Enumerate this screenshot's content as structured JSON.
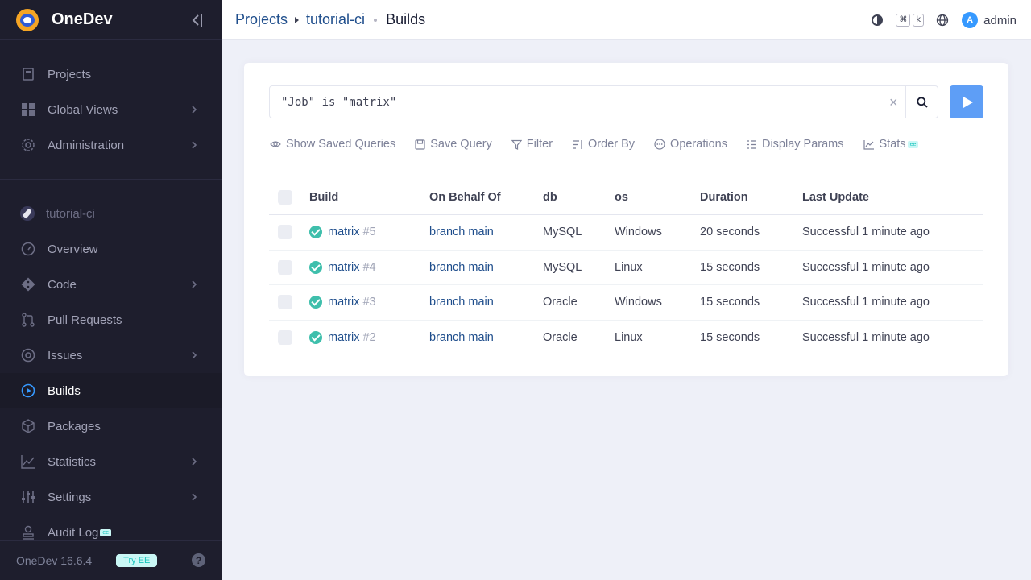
{
  "sidebar": {
    "brand": "OneDev",
    "global_items": [
      {
        "label": "Projects",
        "icon": "projects-icon",
        "chevron": false
      },
      {
        "label": "Global Views",
        "icon": "grid-icon",
        "chevron": true
      },
      {
        "label": "Administration",
        "icon": "gear-icon",
        "chevron": true
      }
    ],
    "project": "tutorial-ci",
    "project_items": [
      {
        "label": "Overview",
        "icon": "gauge-icon",
        "chevron": false
      },
      {
        "label": "Code",
        "icon": "git-icon",
        "chevron": true
      },
      {
        "label": "Pull Requests",
        "icon": "pull-request-icon",
        "chevron": false
      },
      {
        "label": "Issues",
        "icon": "issue-icon",
        "chevron": true
      },
      {
        "label": "Builds",
        "icon": "play-circle-icon",
        "chevron": false,
        "active": true
      },
      {
        "label": "Packages",
        "icon": "package-icon",
        "chevron": false
      },
      {
        "label": "Statistics",
        "icon": "chart-icon",
        "chevron": true
      },
      {
        "label": "Settings",
        "icon": "sliders-icon",
        "chevron": true
      },
      {
        "label": "Audit Log",
        "icon": "stamp-icon",
        "chevron": false,
        "badge": "ee"
      }
    ],
    "version": "OneDev 16.6.4",
    "try_ee": "Try EE",
    "help": "?"
  },
  "topbar": {
    "breadcrumb": [
      "Projects",
      "tutorial-ci",
      "Builds"
    ],
    "kbd": [
      "⌘",
      "k"
    ],
    "avatar_letter": "A",
    "user": "admin"
  },
  "query": {
    "value": "\"Job\" is \"matrix\"",
    "clear": "×"
  },
  "toolbar": {
    "saved": "Show Saved Queries",
    "save": "Save Query",
    "filter": "Filter",
    "order": "Order By",
    "operations": "Operations",
    "params": "Display Params",
    "stats": "Stats",
    "stats_badge": "ee"
  },
  "table": {
    "headers": [
      "Build",
      "On Behalf Of",
      "db",
      "os",
      "Duration",
      "Last Update"
    ],
    "rows": [
      {
        "job": "matrix",
        "num": "#5",
        "behalf": "branch main",
        "db": "MySQL",
        "os": "Windows",
        "duration": "20 seconds",
        "update": "Successful 1 minute ago"
      },
      {
        "job": "matrix",
        "num": "#4",
        "behalf": "branch main",
        "db": "MySQL",
        "os": "Linux",
        "duration": "15 seconds",
        "update": "Successful 1 minute ago"
      },
      {
        "job": "matrix",
        "num": "#3",
        "behalf": "branch main",
        "db": "Oracle",
        "os": "Windows",
        "duration": "15 seconds",
        "update": "Successful 1 minute ago"
      },
      {
        "job": "matrix",
        "num": "#2",
        "behalf": "branch main",
        "db": "Oracle",
        "os": "Linux",
        "duration": "15 seconds",
        "update": "Successful 1 minute ago"
      }
    ]
  },
  "colors": {
    "sidebar_bg": "#1e1e2d",
    "accent": "#5e9ef6",
    "link": "#1f4e8c",
    "success": "#3fbfac"
  }
}
